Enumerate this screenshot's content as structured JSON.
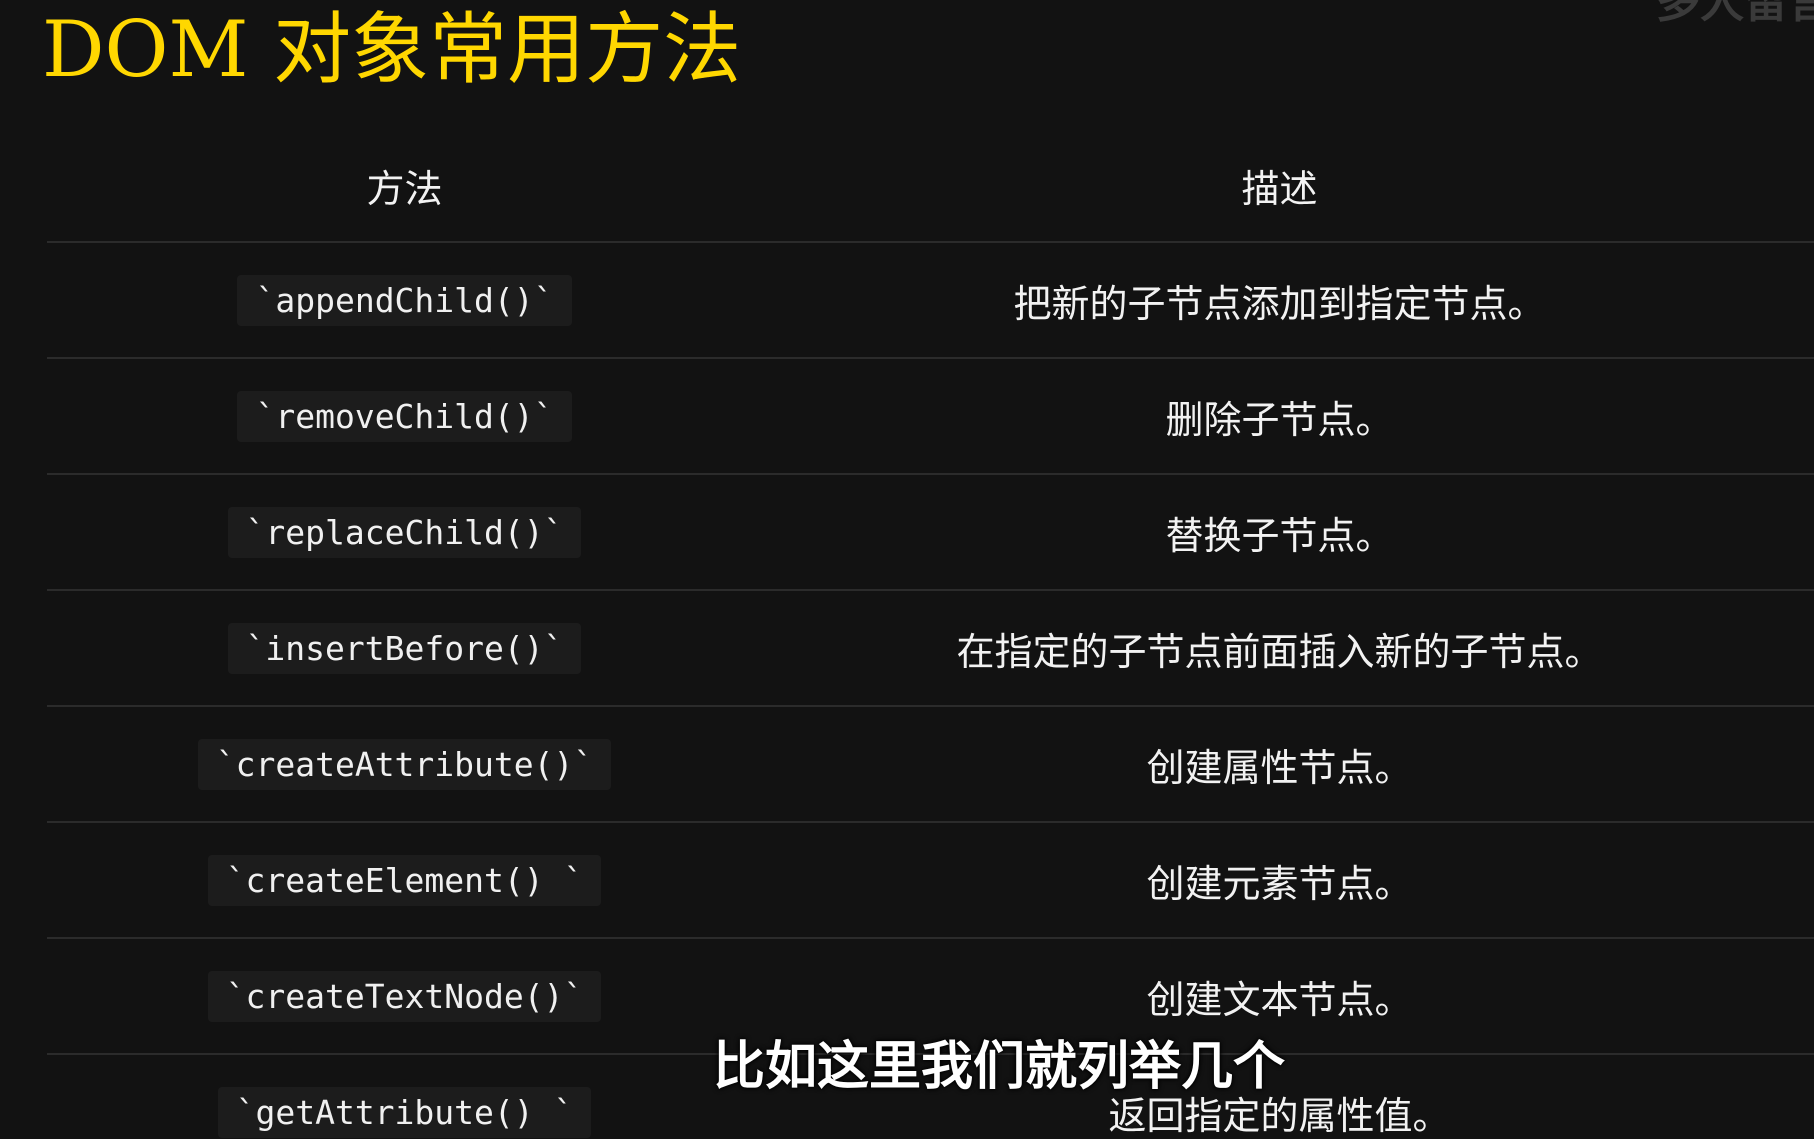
{
  "title": "DOM 对象常用方法",
  "corner_text": "多人留言",
  "table": {
    "headers": {
      "method": "方法",
      "description": "描述"
    },
    "rows": [
      {
        "method": "`appendChild()`",
        "description": "把新的子节点添加到指定节点。"
      },
      {
        "method": "`removeChild()`",
        "description": "删除子节点。"
      },
      {
        "method": "`replaceChild()`",
        "description": "替换子节点。"
      },
      {
        "method": "`insertBefore()`",
        "description": "在指定的子节点前面插入新的子节点。"
      },
      {
        "method": "`createAttribute()`",
        "description": "创建属性节点。"
      },
      {
        "method": "`createElement() `",
        "description": "创建元素节点。"
      },
      {
        "method": "`createTextNode()`",
        "description": "创建文本节点。"
      },
      {
        "method": "`getAttribute() `",
        "description": "返回指定的属性值。"
      }
    ]
  },
  "subtitle": "比如这里我们就列举几个",
  "colors": {
    "background": "#121212",
    "title": "#ffd700",
    "text": "#f2f2f2",
    "divider": "#2b2b2b"
  }
}
